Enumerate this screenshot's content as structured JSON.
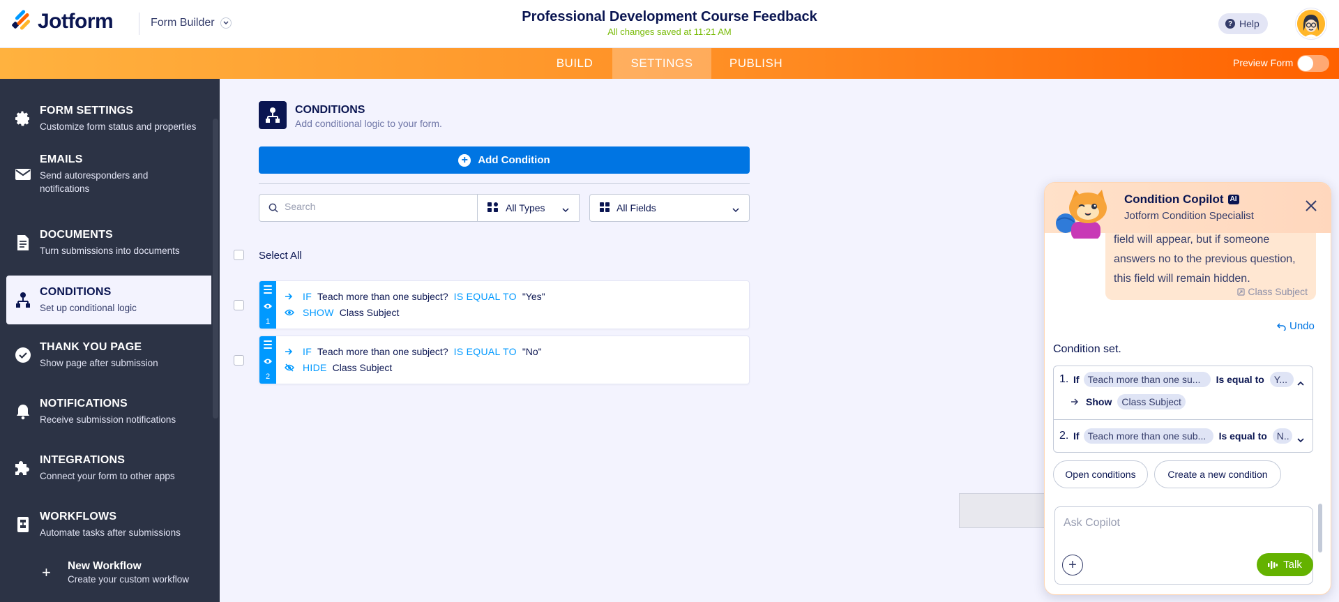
{
  "header": {
    "brand": "Jotform",
    "builder_menu": "Form Builder",
    "form_title": "Professional Development Course Feedback",
    "save_status": "All changes saved at 11:21 AM",
    "help_label": "Help"
  },
  "nav": {
    "tabs": [
      {
        "label": "BUILD"
      },
      {
        "label": "SETTINGS"
      },
      {
        "label": "PUBLISH"
      }
    ],
    "active_tab": "SETTINGS",
    "preview_label": "Preview Form",
    "preview_on": false
  },
  "sidebar": {
    "items": [
      {
        "title": "FORM SETTINGS",
        "sub": "Customize form status and properties",
        "icon": "gear-icon"
      },
      {
        "title": "EMAILS",
        "sub": "Send autoresponders and notifications",
        "icon": "envelope-icon"
      },
      {
        "title": "DOCUMENTS",
        "sub": "Turn submissions into documents",
        "icon": "document-icon"
      },
      {
        "title": "CONDITIONS",
        "sub": "Set up conditional logic",
        "icon": "conditions-icon"
      },
      {
        "title": "THANK YOU PAGE",
        "sub": "Show page after submission",
        "icon": "check-circle-icon"
      },
      {
        "title": "NOTIFICATIONS",
        "sub": "Receive submission notifications",
        "icon": "bell-icon"
      },
      {
        "title": "INTEGRATIONS",
        "sub": "Connect your form to other apps",
        "icon": "puzzle-icon"
      },
      {
        "title": "WORKFLOWS",
        "sub": "Automate tasks after submissions",
        "icon": "workflow-icon"
      }
    ],
    "active_item": "CONDITIONS",
    "new_workflow": {
      "title": "New Workflow",
      "sub": "Create your custom workflow"
    }
  },
  "conditions": {
    "title": "CONDITIONS",
    "subtitle": "Add conditional logic to your form.",
    "add_button": "Add Condition",
    "search_placeholder": "Search",
    "type_filter": "All Types",
    "field_filter": "All Fields",
    "select_all": "Select All",
    "rules": [
      {
        "number": "1",
        "if_kw": "IF",
        "field": "Teach more than one subject?",
        "op": "IS EQUAL TO",
        "value": "\"Yes\"",
        "action": "SHOW",
        "target": "Class Subject"
      },
      {
        "number": "2",
        "if_kw": "IF",
        "field": "Teach more than one subject?",
        "op": "IS EQUAL TO",
        "value": "\"No\"",
        "action": "HIDE",
        "target": "Class Subject"
      }
    ]
  },
  "copilot": {
    "title": "Condition Copilot",
    "badge": "AI",
    "subtitle": "Jotform Condition Specialist",
    "user_message": "field will appear, but if someone answers no to the previous question, this field will remain hidden.",
    "user_ref": "Class Subject",
    "undo_label": "Undo",
    "status": "Condition set.",
    "conditions": [
      {
        "number": "1.",
        "if": "If",
        "field": "Teach more than one su...",
        "op": "Is equal to",
        "value": "Y...",
        "action": "Show",
        "target": "Class Subject",
        "expanded": true
      },
      {
        "number": "2.",
        "if": "If",
        "field": "Teach more than one sub...",
        "op": "Is equal to",
        "value": "N..",
        "expanded": false
      }
    ],
    "open_button": "Open conditions",
    "create_button": "Create a new condition",
    "ask_placeholder": "Ask Copilot",
    "talk_label": "Talk"
  },
  "colors": {
    "brand_navy": "#0a1551",
    "accent_blue": "#0075e3",
    "rule_blue": "#0099ff",
    "sidebar_bg": "#2c3345",
    "nav_orange": "#ff8e24",
    "talk_green": "#64b200",
    "save_green": "#78bb07"
  }
}
